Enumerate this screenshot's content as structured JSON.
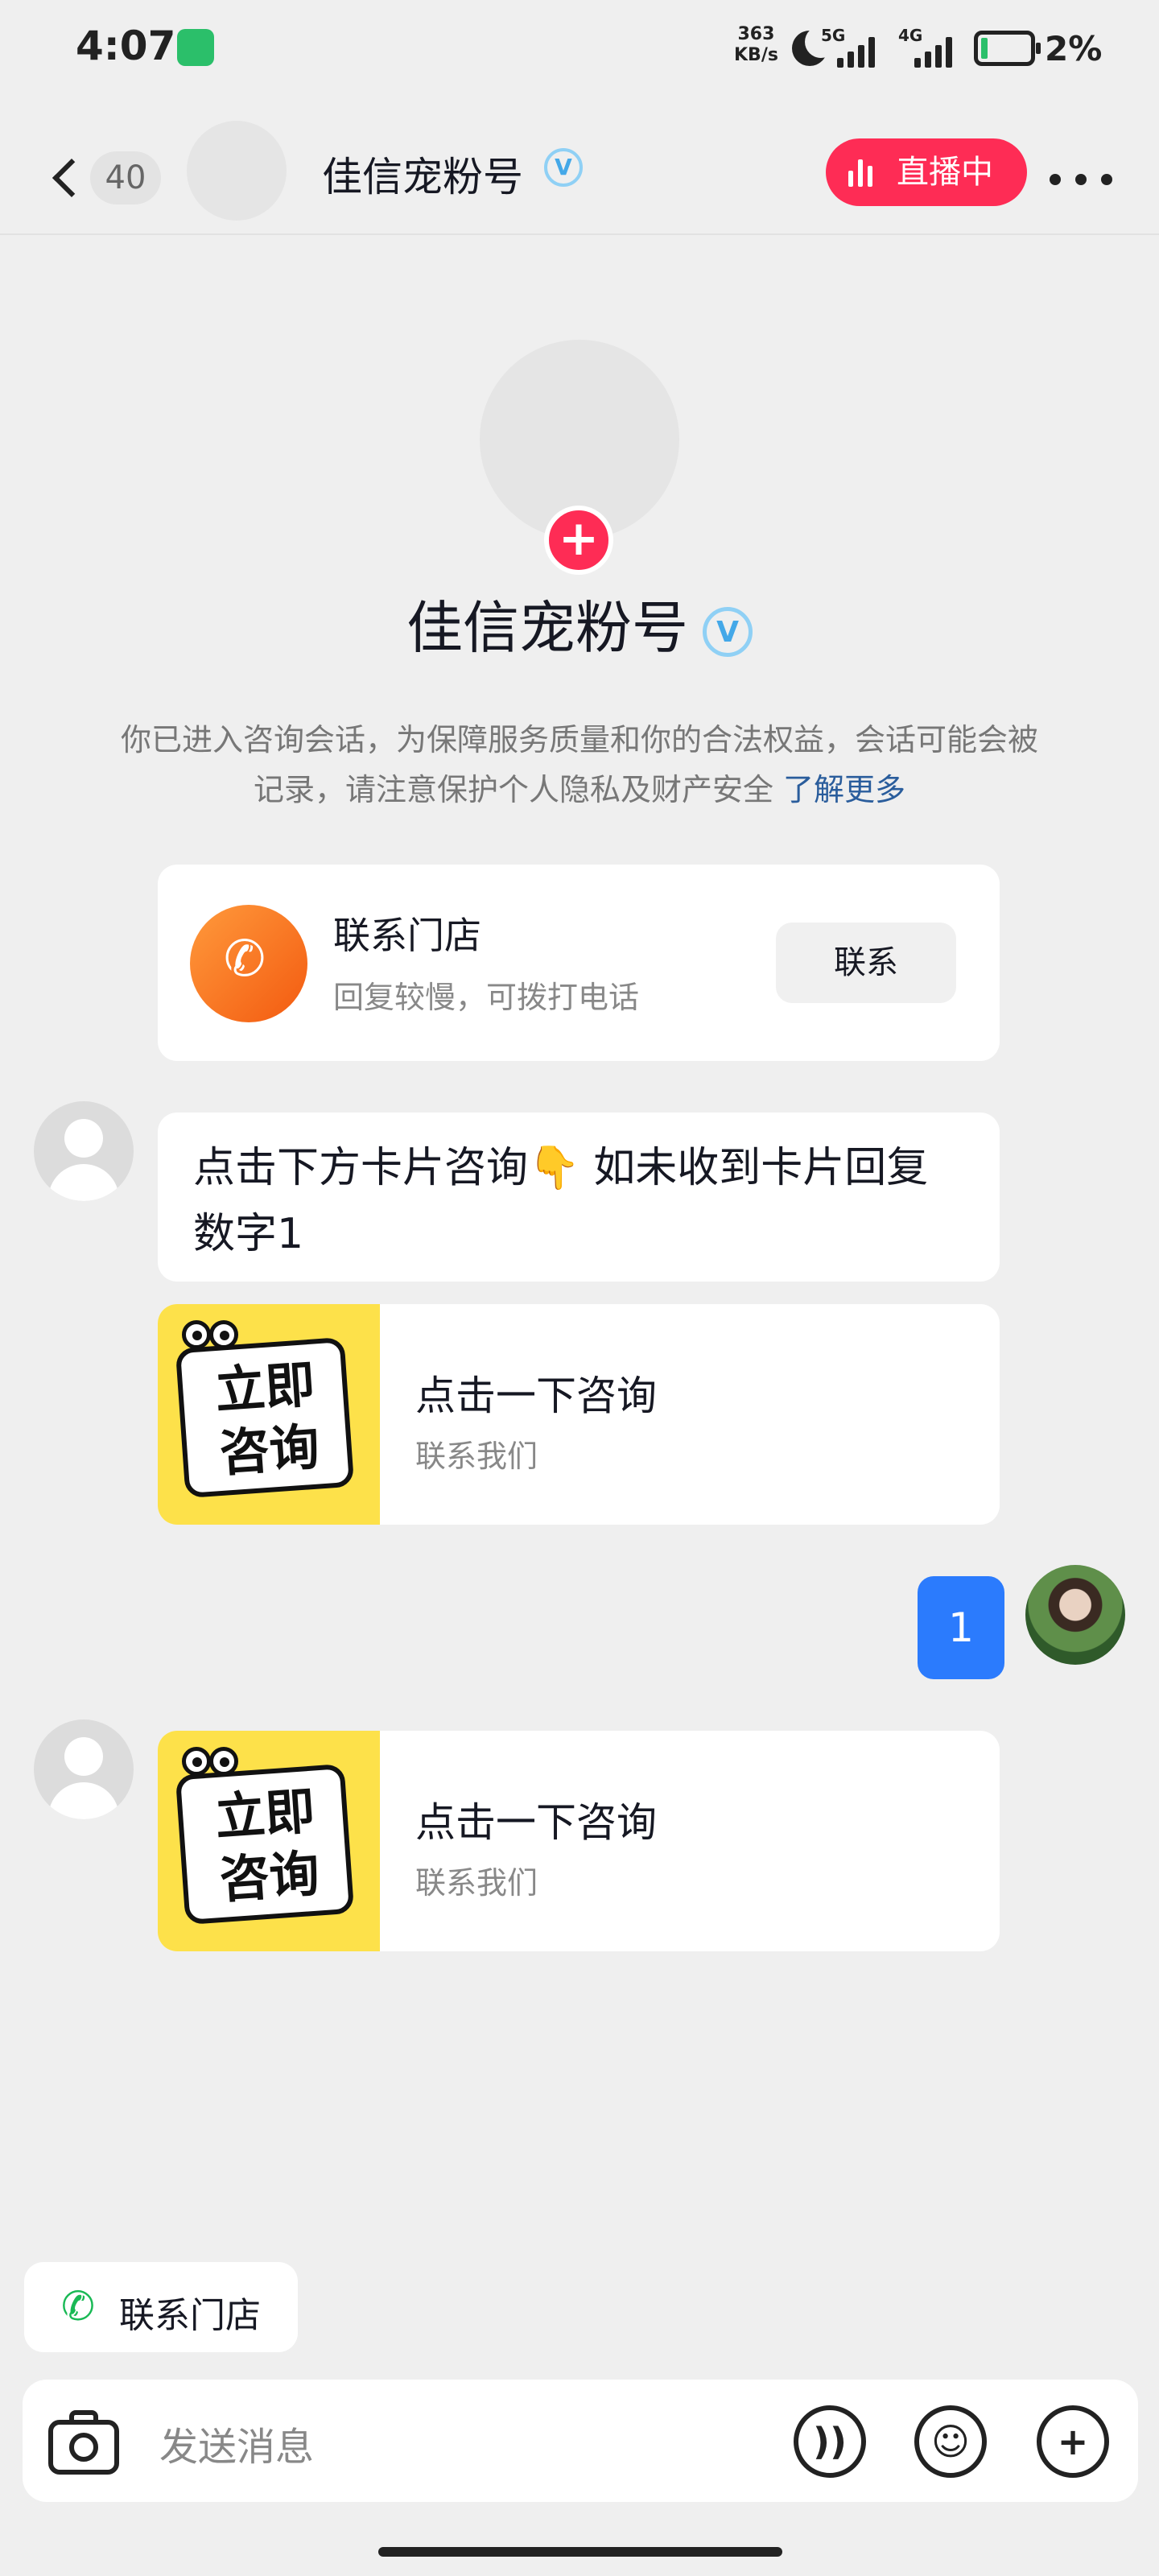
{
  "status_bar": {
    "time": "4:07",
    "speed_value": "363",
    "speed_unit": "KB/s",
    "net1": "5G",
    "net2": "4G",
    "battery": "2%"
  },
  "header": {
    "back_count": "40",
    "name": "佳信宠粉号",
    "verified": "V",
    "live_label": "直播中"
  },
  "profile": {
    "name": "佳信宠粉号",
    "verified": "V",
    "notice": "你已进入咨询会话，为保障服务质量和你的合法权益，会话可能会被记录，请注意保护个人隐私及财产安全",
    "notice_link": "了解更多"
  },
  "contact_card": {
    "title": "联系门店",
    "subtitle": "回复较慢，可拨打电话",
    "button": "联系"
  },
  "messages": [
    {
      "sender": "merchant",
      "text": "点击下方卡片咨询👇 如未收到卡片回复数字1"
    },
    {
      "sender": "merchant",
      "card_title": "点击一下咨询",
      "card_subtitle": "联系我们",
      "card_image_text": [
        "立即",
        "咨询"
      ]
    },
    {
      "sender": "me",
      "text": "1"
    },
    {
      "sender": "merchant",
      "card_title": "点击一下咨询",
      "card_subtitle": "联系我们",
      "card_image_text": [
        "立即",
        "咨询"
      ]
    }
  ],
  "quick_action": {
    "label": "联系门店",
    "icon": "phone-icon"
  },
  "input": {
    "placeholder": "发送消息"
  },
  "colors": {
    "live": "#fe2c55",
    "my_bubble": "#2b7bfd",
    "link": "#2a5d9c",
    "phone_green": "#19b955"
  }
}
